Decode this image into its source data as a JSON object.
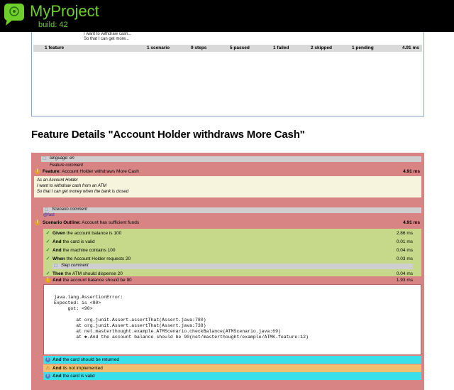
{
  "header": {
    "project_name": "MyProject",
    "build_label": "build: 42"
  },
  "stats": {
    "peek_lines": [
      "I want to withdraw cash...",
      "So that I can get more..."
    ],
    "totals": {
      "features": "1 feature",
      "scenarios": "1 scenario",
      "steps": "9 steps",
      "passed": "5 passed",
      "failed": "1 failed",
      "skipped": "2 skipped",
      "pending": "1 pending",
      "duration": "4.91 ms"
    }
  },
  "feature_details_title": "Feature Details \"Account Holder withdraws More Cash\"",
  "report": {
    "language_line": "language: en",
    "feature_comment": "Feature comment",
    "feature": {
      "keyword": "Feature:",
      "name": "Account Holder withdraws More Cash",
      "duration": "4.91 ms"
    },
    "description": [
      "As an Account Holder",
      "I want to withdraw cash from an ATM",
      "So that I can get money when the bank is closed"
    ],
    "scenario_comment": "Scenario comment",
    "tag": "@fast",
    "scenario": {
      "keyword": "Scenario Outline:",
      "name": "Account has sufficient funds",
      "duration": "4.91 ms"
    },
    "steps": [
      {
        "keyword": "Given",
        "text": "the account balance is 100",
        "duration": "2.86 ms",
        "status": "passed"
      },
      {
        "keyword": "And",
        "text": "the card is valid",
        "duration": "0.01 ms",
        "status": "passed"
      },
      {
        "keyword": "And",
        "text": "the machine contains 100",
        "duration": "0.04 ms",
        "status": "passed"
      },
      {
        "keyword": "When",
        "text": "the Account Holder requests 20",
        "duration": "0.03 ms",
        "status": "passed"
      },
      {
        "keyword": "Then",
        "text": "the ATM should dispense 20",
        "duration": "0.04 ms",
        "status": "passed"
      }
    ],
    "step_comment": "Step comment",
    "failed_step": {
      "keyword": "And",
      "text": "the account balance should be 90",
      "duration": "1.93 ms"
    },
    "stacktrace": "java.lang.AssertionError:\nExpected: is <80>\n     got: <90>\n\n\tat org.junit.Assert.assertThat(Assert.java:780)\n\tat org.junit.Assert.assertThat(Assert.java:738)\n\tat net.masterthought.example.ATMScenario.checkBalance(ATMScenario.java:69)\n\tat ✱.And the account balance should be 90(net/masterthought/example/ATMK.feature:12)",
    "trailing_steps": [
      {
        "keyword": "And",
        "text": "the card should be returned",
        "status": "skipped"
      },
      {
        "keyword": "And",
        "text": "its not implemented",
        "status": "pending"
      },
      {
        "keyword": "And",
        "text": "the card is valid",
        "status": "skipped"
      }
    ]
  },
  "colors": {
    "header_bg": "#000000",
    "brand_green": "#6fcf2a",
    "failed_bg": "#d98484",
    "passed_bg": "#c6d98a",
    "skipped_bg": "#39e0ea",
    "pending_bg": "#f0c070"
  }
}
